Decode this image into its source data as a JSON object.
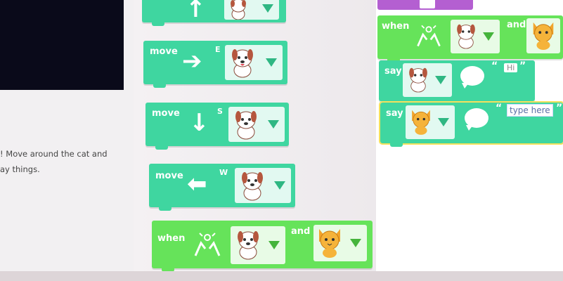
{
  "instructions": {
    "line1": "! Move around the cat and",
    "line2": "ay things."
  },
  "palette": {
    "blocks": [
      {
        "label": "",
        "direction": "",
        "arrow": "up"
      },
      {
        "label": "move",
        "direction": "E",
        "arrow": "right"
      },
      {
        "label": "move",
        "direction": "S",
        "arrow": "down"
      },
      {
        "label": "move",
        "direction": "W",
        "arrow": "left"
      }
    ],
    "when_block": {
      "label": "when",
      "and_label": "and"
    }
  },
  "workspace": {
    "when_block": {
      "label": "when",
      "and_label": "and"
    },
    "say_dog": {
      "label": "say",
      "text": "Hi"
    },
    "say_cat": {
      "label": "say",
      "placeholder": "type here"
    }
  },
  "colors": {
    "block_teal": "#3fd6a0",
    "block_green": "#66e35a",
    "event_purple": "#b45fd1"
  },
  "icons": [
    "dog-icon",
    "cat-icon",
    "dropdown-arrow-icon",
    "sparkle-bump-icon",
    "speech-bubble-icon",
    "arrow-icon"
  ]
}
